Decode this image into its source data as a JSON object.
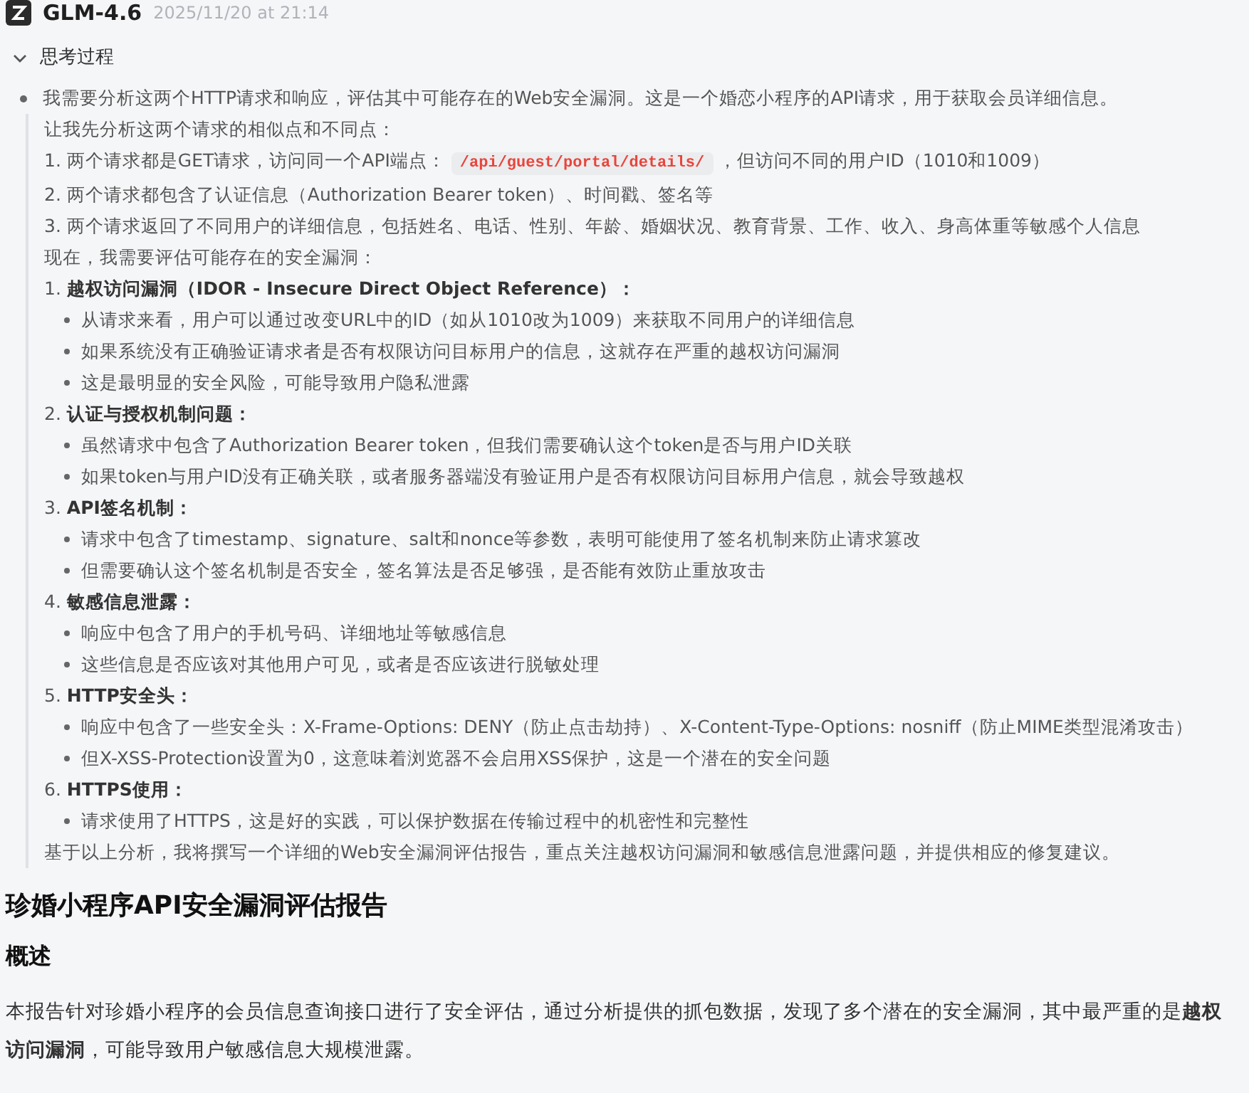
{
  "header": {
    "model": "GLM-4.6",
    "timestamp": "2025/11/20 at 21:14"
  },
  "thinking": {
    "title": "思考过程",
    "expanded": true,
    "intro": "我需要分析这两个HTTP请求和响应，评估其中可能存在的Web安全漏洞。这是一个婚恋小程序的API请求，用于获取会员详细信息。",
    "lines": [
      {
        "kind": "text",
        "text": "让我先分析这两个请求的相似点和不同点："
      },
      {
        "kind": "step",
        "number": "1.",
        "text": "两个请求都是GET请求，访问同一个API端点：",
        "code": "/api/guest/portal/details/",
        "after": "，但访问不同的用户ID（1010和1009）"
      },
      {
        "kind": "step",
        "number": "2.",
        "text": "两个请求都包含了认证信息（Authorization Bearer token）、时间戳、签名等"
      },
      {
        "kind": "step",
        "number": "3.",
        "text": "两个请求返回了不同用户的详细信息，包括姓名、电话、性别、年龄、婚姻状况、教育背景、工作、收入、身高体重等敏感个人信息"
      },
      {
        "kind": "text",
        "text": "现在，我需要评估可能存在的安全漏洞："
      },
      {
        "kind": "section",
        "number": "1.",
        "title": "越权访问漏洞（IDOR - Insecure Direct Object Reference）："
      },
      {
        "kind": "bullet",
        "text": "从请求来看，用户可以通过改变URL中的ID（如从1010改为1009）来获取不同用户的详细信息"
      },
      {
        "kind": "bullet",
        "text": "如果系统没有正确验证请求者是否有权限访问目标用户的信息，这就存在严重的越权访问漏洞"
      },
      {
        "kind": "bullet",
        "text": "这是最明显的安全风险，可能导致用户隐私泄露"
      },
      {
        "kind": "section",
        "number": "2.",
        "title": "认证与授权机制问题："
      },
      {
        "kind": "bullet",
        "text": "虽然请求中包含了Authorization Bearer token，但我们需要确认这个token是否与用户ID关联"
      },
      {
        "kind": "bullet",
        "text": "如果token与用户ID没有正确关联，或者服务器端没有验证用户是否有权限访问目标用户信息，就会导致越权"
      },
      {
        "kind": "section",
        "number": "3.",
        "title": "API签名机制："
      },
      {
        "kind": "bullet",
        "text": "请求中包含了timestamp、signature、salt和nonce等参数，表明可能使用了签名机制来防止请求篡改"
      },
      {
        "kind": "bullet",
        "text": "但需要确认这个签名机制是否安全，签名算法是否足够强，是否能有效防止重放攻击"
      },
      {
        "kind": "section",
        "number": "4.",
        "title": "敏感信息泄露："
      },
      {
        "kind": "bullet",
        "text": "响应中包含了用户的手机号码、详细地址等敏感信息"
      },
      {
        "kind": "bullet",
        "text": "这些信息是否应该对其他用户可见，或者是否应该进行脱敏处理"
      },
      {
        "kind": "section",
        "number": "5.",
        "title": "HTTP安全头："
      },
      {
        "kind": "bullet",
        "text": "响应中包含了一些安全头：X-Frame-Options: DENY（防止点击劫持）、X-Content-Type-Options: nosniff（防止MIME类型混淆攻击）"
      },
      {
        "kind": "bullet",
        "text": "但X-XSS-Protection设置为0，这意味着浏览器不会启用XSS保护，这是一个潜在的安全问题"
      },
      {
        "kind": "section",
        "number": "6.",
        "title": "HTTPS使用："
      },
      {
        "kind": "bullet",
        "text": "请求使用了HTTPS，这是好的实践，可以保护数据在传输过程中的机密性和完整性"
      },
      {
        "kind": "text",
        "text": "基于以上分析，我将撰写一个详细的Web安全漏洞评估报告，重点关注越权访问漏洞和敏感信息泄露问题，并提供相应的修复建议。"
      }
    ]
  },
  "report": {
    "title": "珍婚小程序API安全漏洞评估报告",
    "section": "概述",
    "paragraph": "本报告针对珍婚小程序的会员信息查询接口进行了安全评估，通过分析提供的抓包数据，发现了多个潜在的安全漏洞，其中最严重的是**越权访问漏洞**，可能导致用户敏感信息大规模泄露。"
  }
}
